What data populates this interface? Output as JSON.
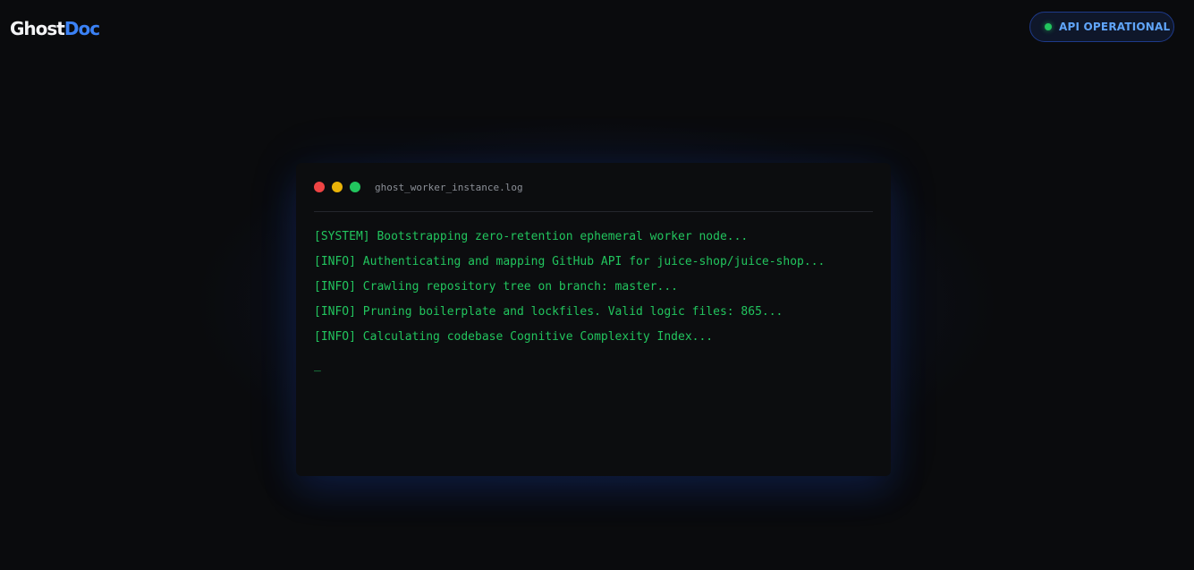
{
  "header": {
    "logo_part1": "Ghost",
    "logo_part2": "Doc",
    "status": {
      "label": "API OPERATIONAL",
      "dot_color": "#22c55e",
      "dot_icon": "status-dot-icon"
    }
  },
  "terminal": {
    "title": "ghost_worker_instance.log",
    "window_controls": [
      {
        "name": "close",
        "color": "#ef4444"
      },
      {
        "name": "minimize",
        "color": "#eab308"
      },
      {
        "name": "maximize",
        "color": "#22c55e"
      }
    ],
    "lines": [
      "[SYSTEM] Bootstrapping zero-retention ephemeral worker node...",
      "[INFO] Authenticating and mapping GitHub API for juice-shop/juice-shop...",
      "[INFO] Crawling repository tree on branch: master...",
      "[INFO] Pruning boilerplate and lockfiles. Valid logic files: 865...",
      "[INFO] Calculating codebase Cognitive Complexity Index..."
    ],
    "cursor": "_",
    "text_color": "#22c55e"
  }
}
